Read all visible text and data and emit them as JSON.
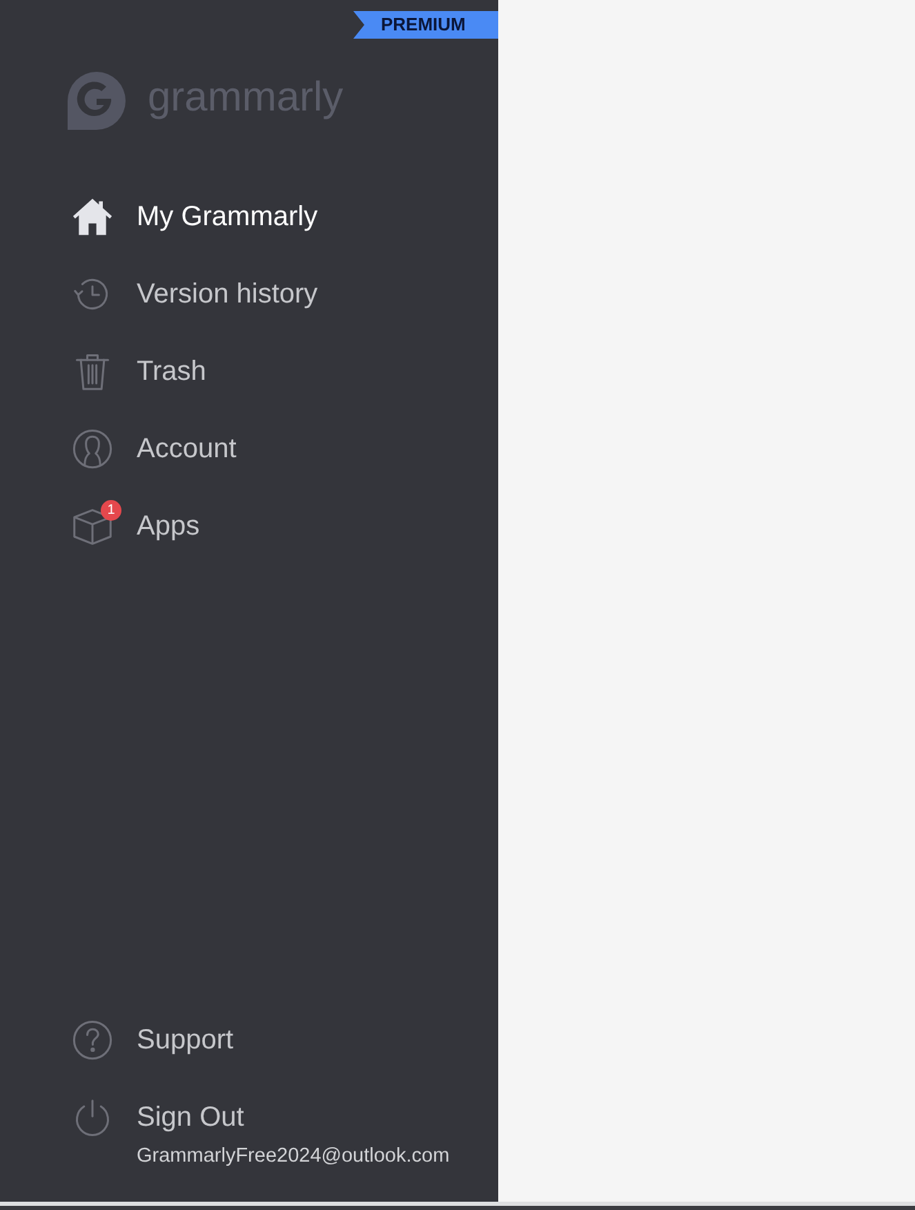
{
  "premium_ribbon": {
    "label": "PREMIUM"
  },
  "logo": {
    "wordmark": "grammarly"
  },
  "nav": [
    {
      "kind": "home",
      "label": "My Grammarly",
      "selected": true
    },
    {
      "kind": "history",
      "label": "Version history",
      "selected": false
    },
    {
      "kind": "trash",
      "label": "Trash",
      "selected": false
    },
    {
      "kind": "account",
      "label": "Account",
      "selected": false
    },
    {
      "kind": "apps",
      "label": "Apps",
      "selected": false,
      "badge": "1"
    }
  ],
  "footer_nav": [
    {
      "kind": "help",
      "label": "Support"
    },
    {
      "kind": "sign_out",
      "label": "Sign Out"
    }
  ],
  "account": {
    "email": "GrammarlyFree2024@outlook.com"
  }
}
